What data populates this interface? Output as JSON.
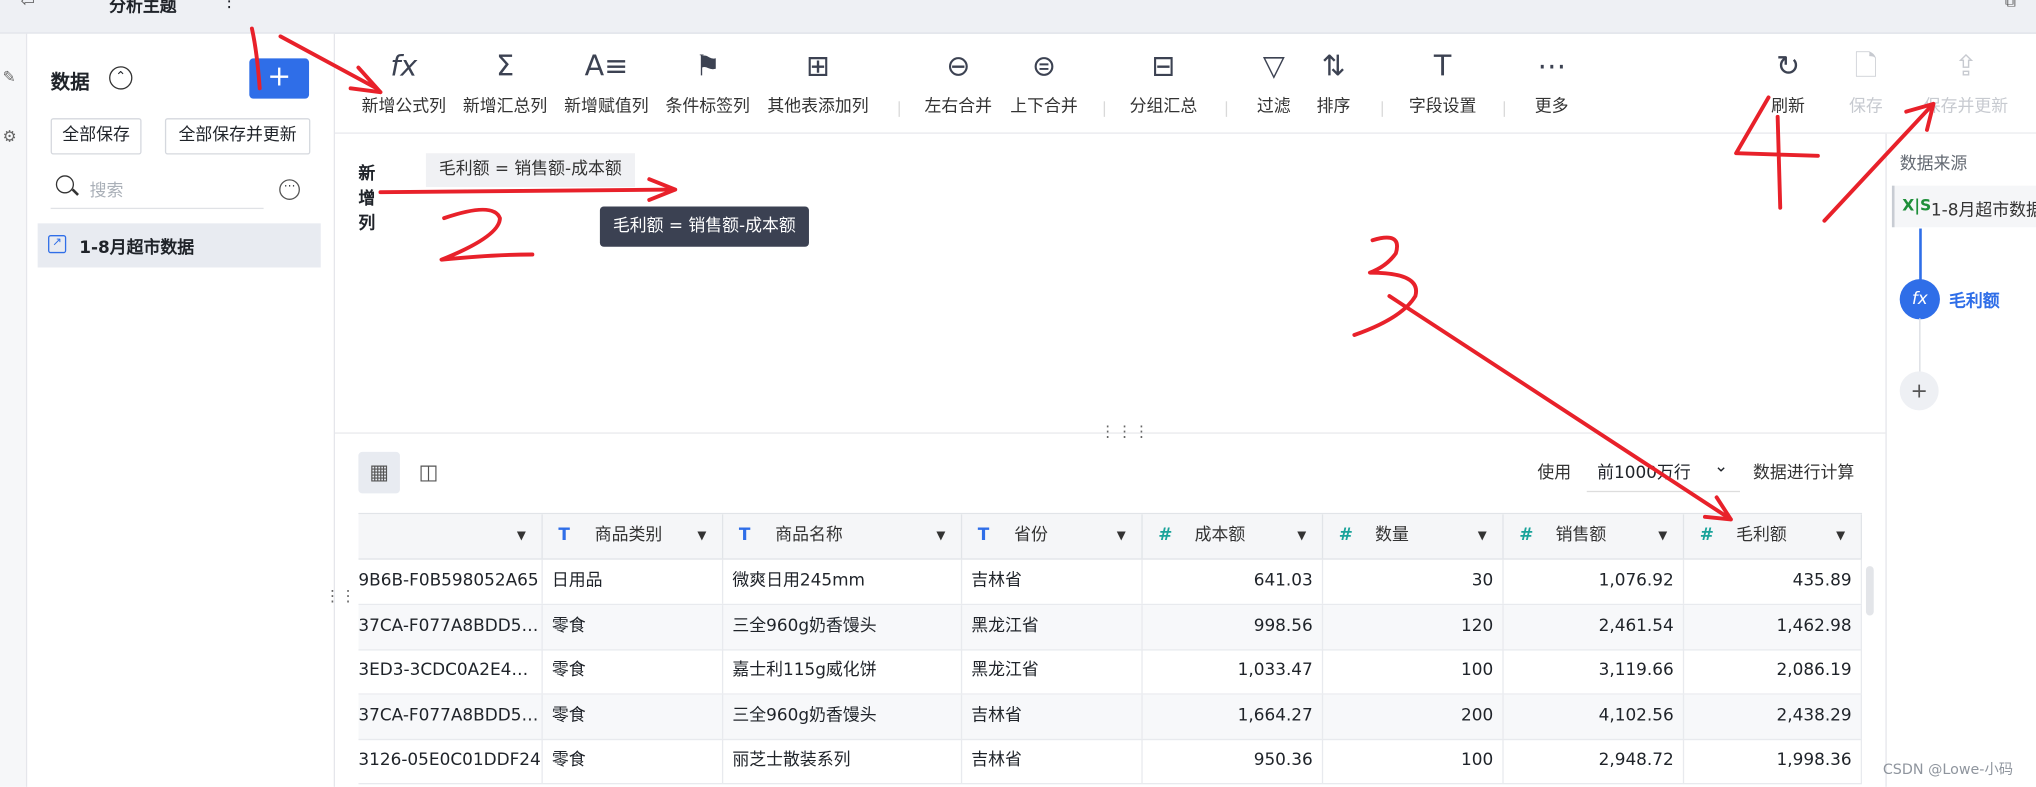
{
  "topbar": {
    "title": "分析主题",
    "more": "⋮",
    "back_glyph": "⇦",
    "right_glyph": "⧉"
  },
  "sidebar": {
    "title": "数据",
    "add_button": "+",
    "save_all": "全部保存",
    "save_all_update": "全部保存并更新",
    "search_placeholder": "搜索",
    "items": [
      {
        "label": "1-8月超市数据"
      }
    ]
  },
  "toolbar": {
    "tools": [
      {
        "icon": "fx",
        "label": "新增公式列"
      },
      {
        "icon": "Σ",
        "label": "新增汇总列"
      },
      {
        "icon": "A≡",
        "label": "新增赋值列"
      },
      {
        "icon": "⚑",
        "label": "条件标签列"
      },
      {
        "icon": "⊞",
        "label": "其他表添加列"
      },
      {
        "icon": "⊖",
        "label": "左右合并"
      },
      {
        "icon": "⊜",
        "label": "上下合并"
      },
      {
        "icon": "⊟",
        "label": "分组汇总"
      },
      {
        "icon": "▽",
        "label": "过滤"
      },
      {
        "icon": "⇅",
        "label": "排序"
      },
      {
        "icon": "T",
        "label": "字段设置"
      },
      {
        "icon": "⋯",
        "label": "更多"
      },
      {
        "icon": "↻",
        "label": "刷新"
      },
      {
        "icon": "🗋",
        "label": "保存"
      },
      {
        "icon": "⇪",
        "label": "保存并更新"
      }
    ]
  },
  "formula": {
    "label": "新增列",
    "expression": "毛利额 = 销售额-成本额",
    "tooltip": "毛利额 = 销售额-成本额"
  },
  "grid_controls": {
    "use_label": "使用",
    "rows_value": "前1000万行",
    "compute_label": "数据进行计算"
  },
  "right_panel": {
    "title": "数据来源",
    "source_icon": "X|S",
    "source_name": "1-8月超市数据",
    "node_icon": "fx",
    "node_label": "毛利额",
    "add": "+"
  },
  "table": {
    "columns": [
      {
        "type": "",
        "name": ""
      },
      {
        "type": "T",
        "name": "商品类别"
      },
      {
        "type": "T",
        "name": "商品名称"
      },
      {
        "type": "T",
        "name": "省份"
      },
      {
        "type": "#",
        "name": "成本额"
      },
      {
        "type": "#",
        "name": "数量"
      },
      {
        "type": "#",
        "name": "销售额"
      },
      {
        "type": "#",
        "name": "毛利额"
      }
    ],
    "rows": [
      [
        "9B6B-F0B598052A65",
        "日用品",
        "微爽日用245mm",
        "吉林省",
        "641.03",
        "30",
        "1,076.92",
        "435.89"
      ],
      [
        "37CA-F077A8BDD5…",
        "零食",
        "三全960g奶香馒头",
        "黑龙江省",
        "998.56",
        "120",
        "2,461.54",
        "1,462.98"
      ],
      [
        "3ED3-3CDC0A2E4…",
        "零食",
        "嘉士利115g威化饼",
        "黑龙江省",
        "1,033.47",
        "100",
        "3,119.66",
        "2,086.19"
      ],
      [
        "37CA-F077A8BDD5…",
        "零食",
        "三全960g奶香馒头",
        "吉林省",
        "1,664.27",
        "200",
        "4,102.56",
        "2,438.29"
      ],
      [
        "3126-05E0C01DDF24",
        "零食",
        "丽芝士散装系列",
        "吉林省",
        "950.36",
        "100",
        "2,948.72",
        "1,998.36"
      ]
    ]
  },
  "watermark": "CSDN @Lowe-小码",
  "annotation_color": "#e8212a"
}
